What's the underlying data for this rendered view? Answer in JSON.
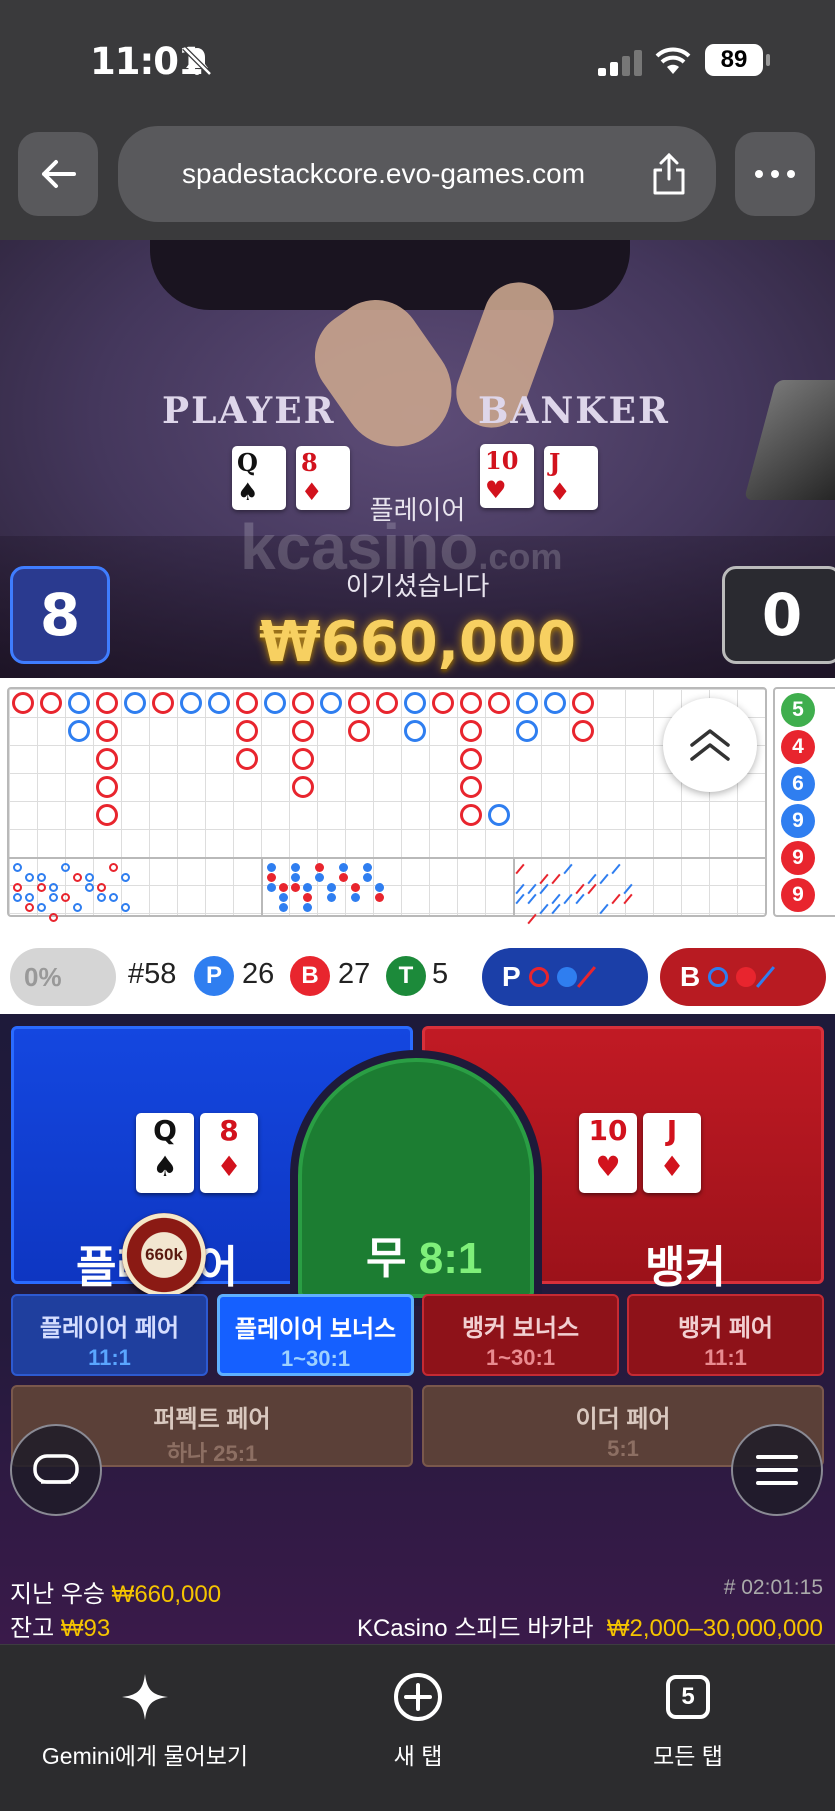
{
  "status": {
    "time": "11:01",
    "battery": "89"
  },
  "browser": {
    "url": "spadestackcore.evo-games.com"
  },
  "table": {
    "player_label": "PLAYER",
    "banker_label": "BANKER",
    "player_cards": [
      {
        "rank": "Q",
        "suit": "♠",
        "color": "black"
      },
      {
        "rank": "8",
        "suit": "♦",
        "color": "red"
      }
    ],
    "banker_cards": [
      {
        "rank": "10",
        "suit": "♥",
        "color": "red"
      },
      {
        "rank": "J",
        "suit": "♦",
        "color": "red"
      }
    ],
    "watermark": "kcasino",
    "watermark_sub": ".com"
  },
  "result": {
    "winner_label": "플레이어",
    "win_text": "이기셨습니다",
    "amount": "₩660,000",
    "player_score": "8",
    "banker_score": "0"
  },
  "predict_column": [
    "5",
    "4",
    "6",
    "9",
    "9",
    "9"
  ],
  "stats": {
    "percent": "0%",
    "shoe": "#58",
    "p_letter": "P",
    "p_count": "26",
    "b_letter": "B",
    "b_count": "27",
    "t_letter": "T",
    "t_count": "5",
    "ask_player": "P",
    "ask_banker": "B"
  },
  "bets": {
    "player": "플레이어",
    "tie": "무",
    "tie_odds": "8:1",
    "banker": "뱅커",
    "chip": "660k",
    "player_cards": [
      {
        "rank": "Q",
        "suit": "♠",
        "color": "black"
      },
      {
        "rank": "8",
        "suit": "♦",
        "color": "red"
      }
    ],
    "banker_cards": [
      {
        "rank": "10",
        "suit": "♥",
        "color": "red"
      },
      {
        "rank": "J",
        "suit": "♦",
        "color": "red"
      }
    ],
    "side_bets": [
      {
        "title": "플레이어 페어",
        "odds": "11:1"
      },
      {
        "title": "플레이어 보너스",
        "odds": "1~30:1"
      },
      {
        "title": "뱅커 보너스",
        "odds": "1~30:1"
      },
      {
        "title": "뱅커 페어",
        "odds": "11:1"
      },
      {
        "title": "퍼펙트 페어",
        "odds": "하나 25:1"
      },
      {
        "title": "이더 페어",
        "odds": "5:1"
      }
    ]
  },
  "footer_info": {
    "last_win_label": "지난 우승",
    "last_win_amount": "₩660,000",
    "balance_label": "잔고",
    "balance_amount": "₩93",
    "round_id": "# 02:01:15",
    "table_name": "KCasino 스피드 바카라",
    "limits": "₩2,000–30,000,000"
  },
  "toolbar": {
    "gemini": "Gemini에게 물어보기",
    "new_tab": "새 탭",
    "tabs_count": "5",
    "all_tabs": "모든 탭"
  },
  "colors": {
    "player_blue": "#2f7ef0",
    "banker_red": "#e8252e",
    "tie_green": "#1c7d32",
    "gold": "#f5c400"
  }
}
